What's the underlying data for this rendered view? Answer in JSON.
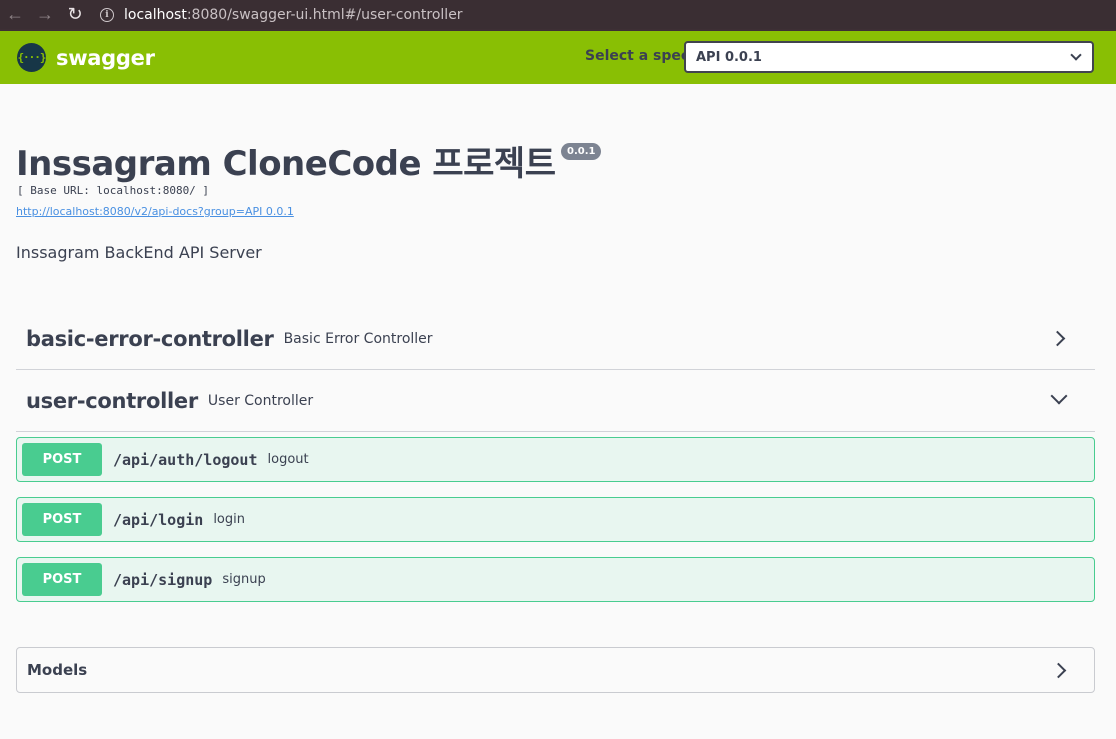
{
  "browser": {
    "url_host": "localhost",
    "url_rest": ":8080/swagger-ui.html#/user-controller",
    "back_glyph": "←",
    "forward_glyph": "→",
    "reload_glyph": "↻",
    "info_glyph": "i"
  },
  "topbar": {
    "logo_mark": "{···}",
    "logo_text": "swagger",
    "spec_label": "Select a spec",
    "spec_value": "API 0.0.1",
    "background": "#89bf04"
  },
  "info": {
    "title": "Inssagram CloneCode 프로젝트",
    "version": "0.0.1",
    "base_url": "[ Base URL: localhost:8080/ ]",
    "api_docs_link": "http://localhost:8080/v2/api-docs?group=API 0.0.1",
    "description": "Inssagram BackEnd API Server"
  },
  "controllers": [
    {
      "name": "basic-error-controller",
      "description": "Basic Error Controller",
      "expanded": false
    },
    {
      "name": "user-controller",
      "description": "User Controller",
      "expanded": true
    }
  ],
  "operations": [
    {
      "method": "POST",
      "path": "/api/auth/logout",
      "summary": "logout"
    },
    {
      "method": "POST",
      "path": "/api/login",
      "summary": "login"
    },
    {
      "method": "POST",
      "path": "/api/signup",
      "summary": "signup"
    }
  ],
  "models": {
    "label": "Models"
  },
  "colors": {
    "post": "#49cc90",
    "post_bg": "#e8f6f0",
    "link": "#4990e2",
    "text": "#3b4151"
  }
}
